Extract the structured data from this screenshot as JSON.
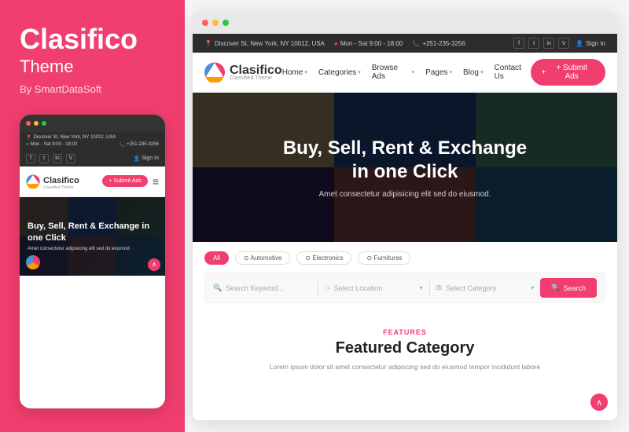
{
  "left": {
    "brand": {
      "title": "Clasifico",
      "subtitle": "Theme",
      "by": "By SmartDataSoft"
    },
    "mobile": {
      "topbar": {
        "address": "Discover St, New York, NY 10012, USA",
        "hours": "Mon - Sat 9:00 - 18:00",
        "phone": "+251-235-3256"
      },
      "social": [
        "f",
        "t",
        "in",
        "V"
      ],
      "signin": "Sign In",
      "logo_text": "Clasifico",
      "logo_sub": "Classified Theme",
      "submit_btn": "+ Submit Ads",
      "hero_title": "Buy, Sell, Rent & Exchange in one Click",
      "hero_sub": "Amet consectetur adipisicing elit sed do eiusmod"
    }
  },
  "right": {
    "topbar": {
      "address": "Discover St, New York, NY 10012, USA",
      "hours": "Mon - Sat 9:00 - 18:00",
      "phone": "+251-235-3256",
      "social": [
        "f",
        "t",
        "in",
        "V"
      ],
      "signin": "Sign In"
    },
    "navbar": {
      "logo_text": "Clasifico",
      "logo_sub": "Classified Theme",
      "menu_items": [
        {
          "label": "Home",
          "has_dropdown": true
        },
        {
          "label": "Categories",
          "has_dropdown": true
        },
        {
          "label": "Browse Ads",
          "has_dropdown": true
        },
        {
          "label": "Pages",
          "has_dropdown": true
        },
        {
          "label": "Blog",
          "has_dropdown": true
        },
        {
          "label": "Contact Us",
          "has_dropdown": false
        }
      ],
      "submit_btn": "+ Submit Ads"
    },
    "hero": {
      "title": "Buy, Sell, Rent & Exchange\nin one Click",
      "subtitle": "Amet consectetur adipisicing elit sed do eiusmod."
    },
    "search": {
      "tabs": [
        {
          "label": "All",
          "active": true
        },
        {
          "label": "Automotive",
          "active": false
        },
        {
          "label": "Electronics",
          "active": false
        },
        {
          "label": "Furnitures",
          "active": false
        }
      ],
      "keyword_placeholder": "Search Keyword...",
      "location_placeholder": "Select Location",
      "category_placeholder": "Select Category",
      "search_btn": "Search"
    },
    "features": {
      "label": "FEATURES",
      "title": "Featured Category",
      "desc": "Lorem ipsum dolor sit amet consectetur adipiscing sed do eiusmod tempor incididunt labore"
    }
  }
}
